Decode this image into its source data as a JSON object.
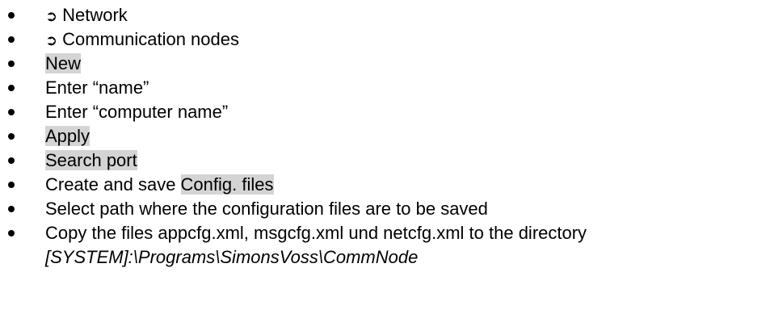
{
  "steps": [
    {
      "arrow": "➲",
      "text": "Network"
    },
    {
      "arrow": "➲",
      "text": "Communication nodes"
    },
    {
      "text": "New"
    },
    {
      "text": "Enter “name”"
    },
    {
      "text": "Enter “computer name”"
    },
    {
      "text": "Apply"
    },
    {
      "text": "Search port"
    },
    {
      "prefix": "Create and save ",
      "highlight": "Config. files"
    },
    {
      "text": "Select path where the configuration files are to be saved"
    },
    {
      "text": "Copy the files appcfg.xml, msgcfg.xml und netcfg.xml to the directory",
      "path": "[SYSTEM]:\\Programs\\SimonsVoss\\CommNode"
    }
  ]
}
